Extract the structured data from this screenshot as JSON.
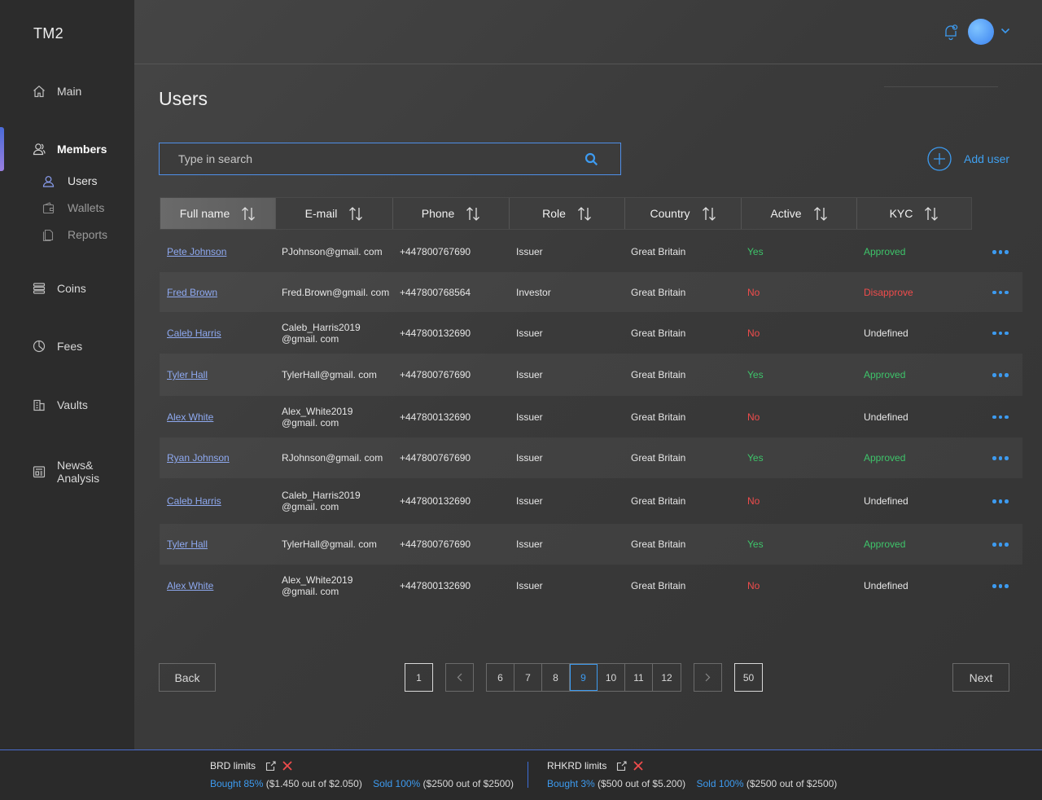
{
  "app": {
    "logo": "TM2"
  },
  "sidebar": {
    "items": [
      {
        "label": "Main",
        "icon": "home-icon"
      },
      {
        "label": "Members",
        "icon": "members-icon"
      },
      {
        "label": "Coins",
        "icon": "coins-icon"
      },
      {
        "label": "Fees",
        "icon": "pie-chart-icon"
      },
      {
        "label": "Vaults",
        "icon": "vault-icon"
      },
      {
        "label": "News&",
        "label2": "Analysis",
        "icon": "news-icon"
      }
    ],
    "subitems": [
      {
        "label": "Users",
        "icon": "user-icon"
      },
      {
        "label": "Wallets",
        "icon": "wallet-icon"
      },
      {
        "label": "Reports",
        "icon": "report-icon"
      }
    ]
  },
  "header": {
    "notifications_icon": "bell-icon",
    "avatar_color": "#4a9af2"
  },
  "page": {
    "title": "Users"
  },
  "search": {
    "placeholder": "Type in search"
  },
  "actions": {
    "add_user": "Add user"
  },
  "table": {
    "columns": [
      "Full name",
      "E-mail",
      "Phone",
      "Role",
      "Country",
      "Active",
      "KYC"
    ],
    "rows": [
      {
        "name": "Pete Johnson",
        "email": "PJohnson@gmail. com",
        "email2": "",
        "phone": "+447800767690",
        "role": "Issuer",
        "country": "Great Britain",
        "active": "Yes",
        "kyc": "Approved"
      },
      {
        "name": "Fred Brown",
        "email": "Fred.Brown@gmail. com",
        "email2": "",
        "phone": "+447800768564",
        "role": "Investor",
        "country": "Great Britain",
        "active": "No",
        "kyc": "Disapprove"
      },
      {
        "name": "Caleb Harris",
        "email": "Caleb_Harris2019",
        "email2": "@gmail. com",
        "phone": "+447800132690",
        "role": "Issuer",
        "country": "Great Britain",
        "active": "No",
        "kyc": "Undefined"
      },
      {
        "name": "Tyler Hall",
        "email": "TylerHall@gmail. com",
        "email2": "",
        "phone": "+447800767690",
        "role": "Issuer",
        "country": "Great Britain",
        "active": "Yes",
        "kyc": "Approved"
      },
      {
        "name": "Alex White",
        "email": "Alex_White2019",
        "email2": "@gmail. com",
        "phone": "+447800132690",
        "role": "Issuer",
        "country": "Great Britain",
        "active": "No",
        "kyc": "Undefined"
      },
      {
        "name": "Ryan Johnson",
        "email": "RJohnson@gmail. com",
        "email2": "",
        "phone": "+447800767690",
        "role": "Issuer",
        "country": "Great Britain",
        "active": "Yes",
        "kyc": "Approved"
      },
      {
        "name": "Caleb Harris",
        "email": "Caleb_Harris2019",
        "email2": "@gmail. com",
        "phone": "+447800132690",
        "role": "Issuer",
        "country": "Great Britain",
        "active": "No",
        "kyc": "Undefined"
      },
      {
        "name": "Tyler Hall",
        "email": "TylerHall@gmail. com",
        "email2": "",
        "phone": "+447800767690",
        "role": "Issuer",
        "country": "Great Britain",
        "active": "Yes",
        "kyc": "Approved"
      },
      {
        "name": "Alex White",
        "email": "Alex_White2019",
        "email2": "@gmail. com",
        "phone": "+447800132690",
        "role": "Issuer",
        "country": "Great Britain",
        "active": "No",
        "kyc": "Undefined"
      }
    ]
  },
  "pagination": {
    "back": "Back",
    "next": "Next",
    "first": "1",
    "pages": [
      "6",
      "7",
      "8",
      "9",
      "10",
      "11",
      "12"
    ],
    "current": "9",
    "last": "50"
  },
  "footer": {
    "limits": [
      {
        "title": "BRD limits",
        "bought_pct": "Bought 85%",
        "bought_detail": " ($1.450 out of $2.050)",
        "sold_pct": "Sold 100%",
        "sold_detail": " ($2500 out of $2500)"
      },
      {
        "title": "RHKRD limits",
        "bought_pct": "Bought 3%",
        "bought_detail": " ($500 out of $5.200)",
        "sold_pct": "Sold 100%",
        "sold_detail": " ($2500 out of $2500)"
      }
    ]
  },
  "colors": {
    "accent": "#3d9bf0",
    "success": "#3ec46a",
    "danger": "#f04c4c",
    "link": "#8ea9f0"
  }
}
